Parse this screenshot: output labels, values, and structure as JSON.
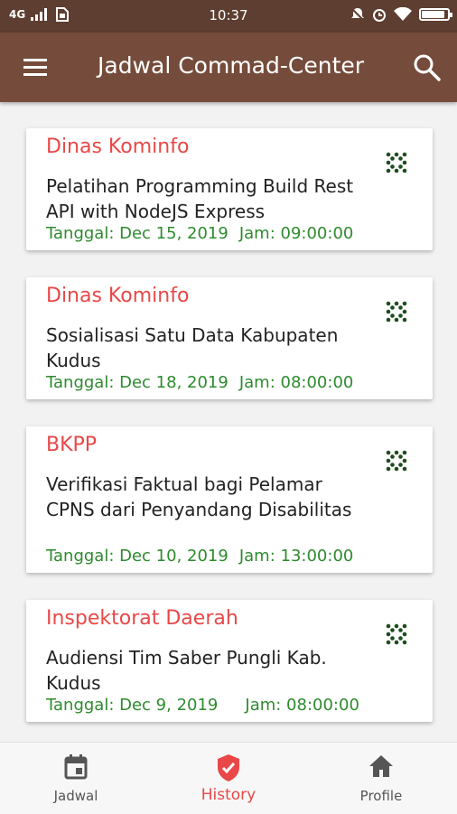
{
  "status_bar": {
    "network": "4G",
    "time": "10:37",
    "battery_level": 0.95
  },
  "app_bar": {
    "title": "Jadwal Commad-Center",
    "menu_icon": "menu-icon",
    "search_icon": "search-icon"
  },
  "schedules": [
    {
      "org": "Dinas Kominfo",
      "desc": "Pelatihan Programming Build Rest API with NodeJS Express",
      "date": "Tanggal: Dec 15, 2019",
      "time": "Jam: 09:00:00"
    },
    {
      "org": "Dinas Kominfo",
      "desc": "Sosialisasi Satu Data Kabupaten Kudus",
      "date": "Tanggal: Dec 18, 2019",
      "time": "Jam: 08:00:00"
    },
    {
      "org": "BKPP",
      "desc": "Verifikasi Faktual bagi Pelamar CPNS dari Penyandang Disabilitas",
      "date": "Tanggal: Dec 10, 2019",
      "time": "Jam: 13:00:00"
    },
    {
      "org": "Inspektorat Daerah",
      "desc": "Audiensi Tim Saber Pungli Kab. Kudus",
      "date": "Tanggal: Dec 9, 2019",
      "time": "Jam: 08:00:00"
    }
  ],
  "bottom_nav": [
    {
      "label": "Jadwal",
      "icon": "calendar-icon",
      "active": false
    },
    {
      "label": "History",
      "icon": "shield-check-icon",
      "active": true
    },
    {
      "label": "Profile",
      "icon": "home-icon",
      "active": false
    }
  ],
  "colors": {
    "status_bar": "#5d3e30",
    "app_bar": "#754c3b",
    "org_text": "#e94848",
    "meta_text": "#2e8b2e",
    "active_nav": "#e94848"
  }
}
